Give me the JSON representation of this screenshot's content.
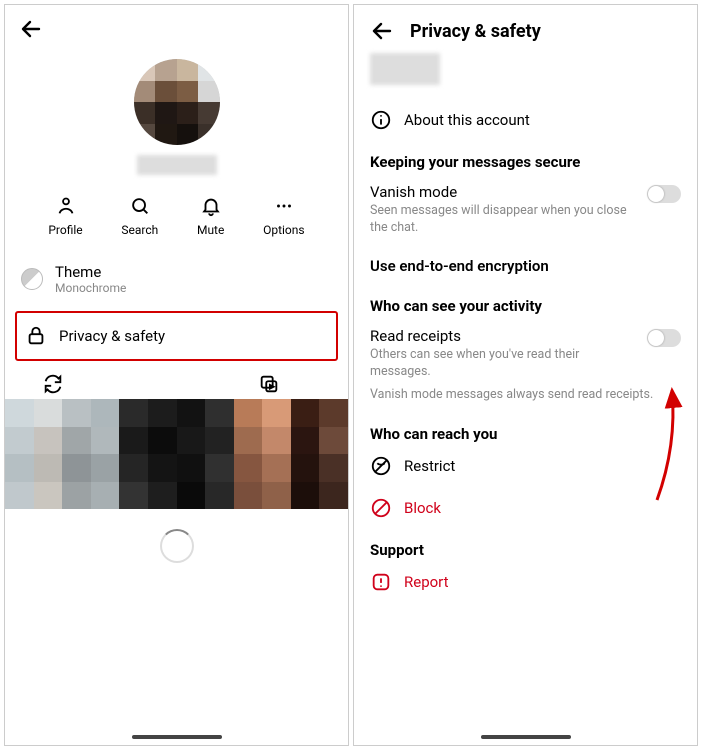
{
  "left": {
    "actions": {
      "profile": "Profile",
      "search": "Search",
      "mute": "Mute",
      "options": "Options"
    },
    "theme": {
      "label": "Theme",
      "sub": "Monochrome"
    },
    "privacy_row": "Privacy & safety"
  },
  "right": {
    "title": "Privacy & safety",
    "about": "About this account",
    "heading_keeping": "Keeping your messages secure",
    "vanish": {
      "title": "Vanish mode",
      "sub": "Seen messages will disappear when you close the chat."
    },
    "e2e": "Use end-to-end encryption",
    "heading_activity": "Who can see your activity",
    "read": {
      "title": "Read receipts",
      "sub1": "Others can see when you've read their messages.",
      "sub2": "Vanish mode messages always send read receipts."
    },
    "heading_reach": "Who can reach you",
    "restrict": "Restrict",
    "block": "Block",
    "heading_support": "Support",
    "report": "Report"
  }
}
